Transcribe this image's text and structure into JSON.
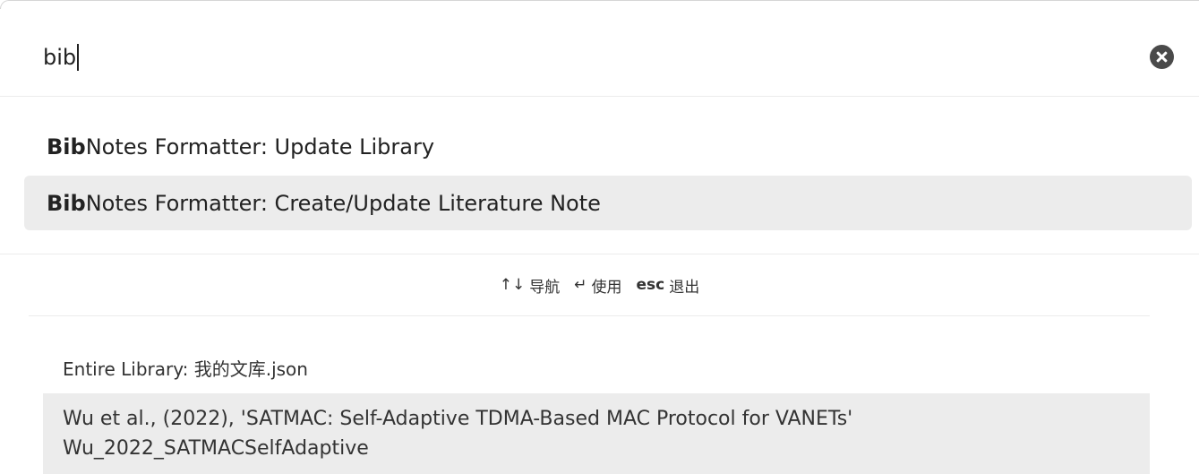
{
  "search": {
    "value": "bib"
  },
  "suggestions": [
    {
      "match": "Bib",
      "rest": "Notes Formatter: Update Library"
    },
    {
      "match": "Bib",
      "rest": "Notes Formatter: Create/Update Literature Note"
    }
  ],
  "instructions": {
    "nav_keys": "↑↓",
    "nav_label": "导航",
    "use_key": "↵",
    "use_label": "使用",
    "esc_key": "esc",
    "esc_label": "退出"
  },
  "library": {
    "label": "Entire Library: 我的文库.json",
    "results": [
      {
        "title": "Wu et al., (2022), 'SATMAC: Self-Adaptive TDMA-Based MAC Protocol for VANETs'",
        "citekey": "Wu_2022_SATMACSelfAdaptive"
      }
    ]
  },
  "icons": {
    "clear": "clear-circle-x-icon"
  },
  "colors": {
    "highlight_bg": "#ececec",
    "clear_button": "#4a4a4a"
  }
}
